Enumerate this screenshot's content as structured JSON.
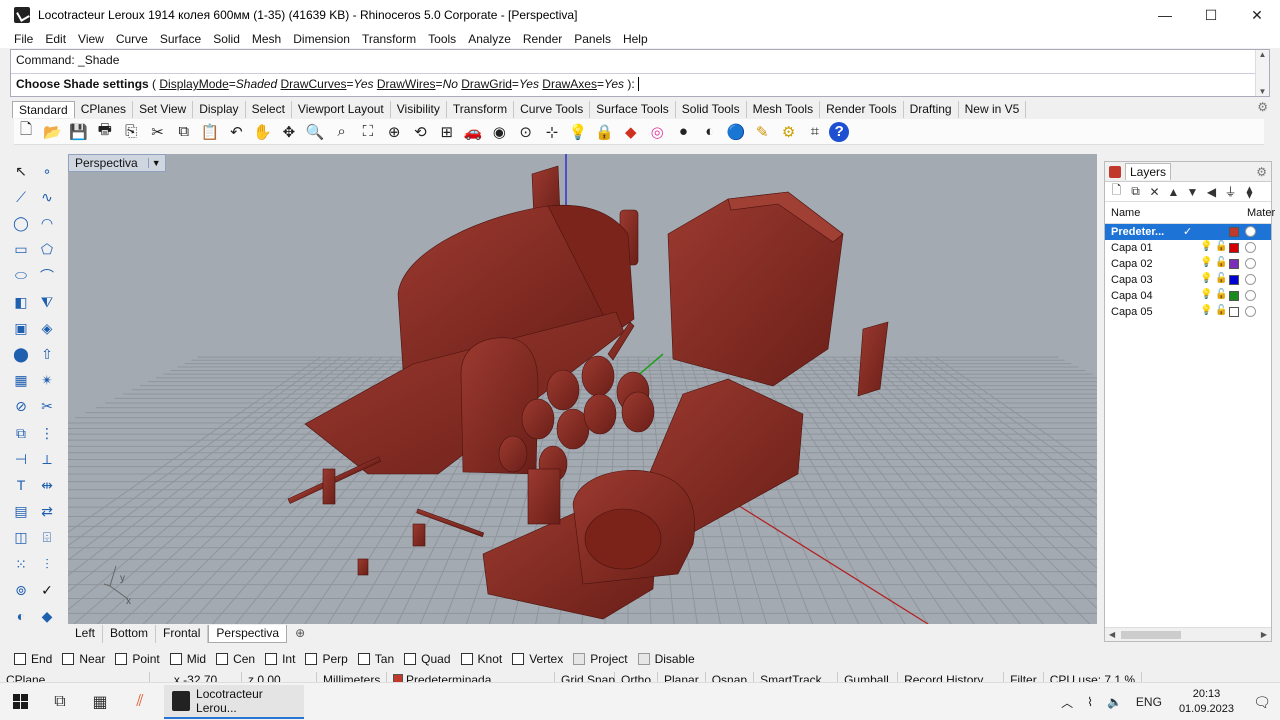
{
  "window": {
    "title": "Locotracteur Leroux 1914 колея 600мм (1-35) (41639 KB) - Rhinoceros  5.0 Corporate - [Perspectiva]",
    "controls": {
      "minimize": "—",
      "maximize": "☐",
      "close": "✕"
    }
  },
  "menu": [
    "File",
    "Edit",
    "View",
    "Curve",
    "Surface",
    "Solid",
    "Mesh",
    "Dimension",
    "Transform",
    "Tools",
    "Analyze",
    "Render",
    "Panels",
    "Help"
  ],
  "command": {
    "history": "Command: _Shade",
    "prompt_label": "Choose Shade settings",
    "options": [
      {
        "name": "DisplayMode",
        "value": "Shaded"
      },
      {
        "name": "DrawCurves",
        "value": "Yes"
      },
      {
        "name": "DrawWires",
        "value": "No"
      },
      {
        "name": "DrawGrid",
        "value": "Yes"
      },
      {
        "name": "DrawAxes",
        "value": "Yes"
      }
    ],
    "suffix": " ):"
  },
  "toolbar_tabs": [
    "Standard",
    "CPlanes",
    "Set View",
    "Display",
    "Select",
    "Viewport Layout",
    "Visibility",
    "Transform",
    "Curve Tools",
    "Surface Tools",
    "Solid Tools",
    "Mesh Tools",
    "Render Tools",
    "Drafting",
    "New in V5"
  ],
  "active_toolbar_tab": "Standard",
  "toolbar_icons": [
    "new-file-icon",
    "open-icon",
    "save-icon",
    "print-icon",
    "import-icon",
    "cut-icon",
    "copy-icon",
    "paste-icon",
    "undo-icon",
    "pan-hand-icon",
    "move-view-icon",
    "zoom-icon",
    "zoom-window-icon",
    "zoom-extents-icon",
    "zoom-selected-icon",
    "rotate-view-icon",
    "four-viewports-icon",
    "car-icon",
    "render-icon",
    "snap-icon",
    "grid-icon",
    "light-icon",
    "lock-icon",
    "material-icon",
    "color-wheel-icon",
    "sphere-icon",
    "shaded-sphere-icon",
    "render-sphere-icon",
    "pencil-icon",
    "settings-gear-icon",
    "hierarchy-icon",
    "help-icon"
  ],
  "viewport": {
    "name": "Perspectiva",
    "axis_x": "x",
    "axis_y": "y",
    "model_color": "#8a2b22",
    "background": "#a4aab2"
  },
  "viewport_tabs": [
    "Left",
    "Bottom",
    "Frontal",
    "Perspectiva"
  ],
  "active_viewport_tab": "Perspectiva",
  "layers_panel": {
    "title": "Layers",
    "col_name": "Name",
    "col_material": "Mater",
    "rows": [
      {
        "name": "Predeter...",
        "current": true,
        "color": "#c0392b"
      },
      {
        "name": "Capa 01",
        "current": false,
        "color": "#d40000"
      },
      {
        "name": "Capa 02",
        "current": false,
        "color": "#7b2fb8"
      },
      {
        "name": "Capa 03",
        "current": false,
        "color": "#0000d0"
      },
      {
        "name": "Capa 04",
        "current": false,
        "color": "#1a8a1a"
      },
      {
        "name": "Capa 05",
        "current": false,
        "color": "#ffffff"
      }
    ]
  },
  "osnaps": [
    "End",
    "Near",
    "Point",
    "Mid",
    "Cen",
    "Int",
    "Perp",
    "Tan",
    "Quad",
    "Knot",
    "Vertex",
    "Project",
    "Disable"
  ],
  "status": {
    "cplane": "CPlane",
    "x": "x -32.70",
    "z": "z 0.00",
    "units": "Millimeters",
    "layer": "Predeterminada",
    "grid_snap": "Grid Snap",
    "ortho": "Ortho",
    "planar": "Planar",
    "osnap": "Osnap",
    "smarttrack": "SmartTrack",
    "gumball": "Gumball",
    "record_history": "Record History",
    "filter": "Filter",
    "cpu": "CPU use: 7.1 %"
  },
  "taskbar": {
    "app_label": "Locotracteur Lerou...",
    "language": "ENG",
    "time": "20:13",
    "date": "01.09.2023"
  }
}
